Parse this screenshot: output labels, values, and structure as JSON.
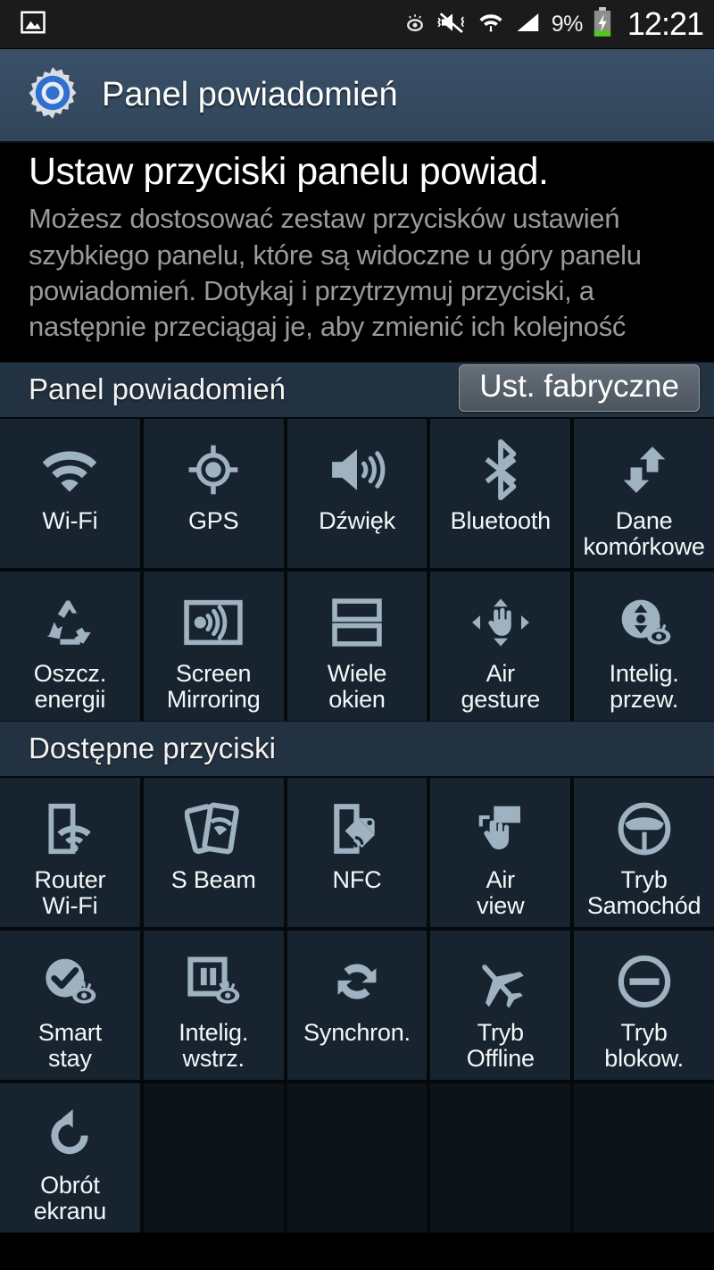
{
  "status_bar": {
    "left_icon": "image-icon",
    "icons": [
      "smart-stay-eye-icon",
      "mute-vibrate-icon",
      "wifi-icon",
      "signal-icon"
    ],
    "battery_percent": "9%",
    "battery_state": "charging",
    "clock": "12:21"
  },
  "action_bar": {
    "icon": "settings-gear-icon",
    "title": "Panel powiadomień"
  },
  "intro": {
    "heading": "Ustaw przyciski panelu powiad.",
    "body": "Możesz dostosować zestaw przycisków ustawień szybkiego panelu, które są widoczne u góry panelu powiadomień. Dotykaj i przytrzymuj przyciski, a następnie przeciągaj je, aby zmienić ich kolejność"
  },
  "panel_section": {
    "title": "Panel powiadomień",
    "reset_button": "Ust. fabryczne",
    "tiles": [
      {
        "label": "Wi-Fi",
        "icon": "wifi-icon"
      },
      {
        "label": "GPS",
        "icon": "gps-crosshair-icon"
      },
      {
        "label": "Dźwięk",
        "icon": "sound-speaker-icon"
      },
      {
        "label": "Bluetooth",
        "icon": "bluetooth-icon"
      },
      {
        "label": "Dane\nkomórkowe",
        "icon": "mobile-data-arrows-icon"
      },
      {
        "label": "Oszcz.\nenergii",
        "icon": "power-saving-recycle-icon"
      },
      {
        "label": "Screen\nMirroring",
        "icon": "screen-mirroring-icon"
      },
      {
        "label": "Wiele\nokien",
        "icon": "multi-window-icon"
      },
      {
        "label": "Air\ngesture",
        "icon": "air-gesture-hand-icon"
      },
      {
        "label": "Intelig.\nprzew.",
        "icon": "smart-scroll-eye-icon"
      }
    ]
  },
  "available_section": {
    "title": "Dostępne przyciski",
    "tiles": [
      {
        "label": "Router\nWi-Fi",
        "icon": "wifi-hotspot-icon"
      },
      {
        "label": "S Beam",
        "icon": "s-beam-icon"
      },
      {
        "label": "NFC",
        "icon": "nfc-tag-icon"
      },
      {
        "label": "Air\nview",
        "icon": "air-view-hand-icon"
      },
      {
        "label": "Tryb\nSamochód",
        "icon": "car-mode-steering-wheel-icon"
      },
      {
        "label": "Smart\nstay",
        "icon": "smart-stay-check-eye-icon"
      },
      {
        "label": "Intelig.\nwstrz.",
        "icon": "smart-pause-eye-icon"
      },
      {
        "label": "Synchron.",
        "icon": "sync-arrows-icon"
      },
      {
        "label": "Tryb\nOffline",
        "icon": "airplane-mode-icon"
      },
      {
        "label": "Tryb\nblokow.",
        "icon": "blocking-mode-minus-icon"
      },
      {
        "label": "Obrót\nekranu",
        "icon": "screen-rotation-icon"
      },
      {
        "label": "",
        "icon": "empty-slot"
      },
      {
        "label": "",
        "icon": "empty-slot"
      },
      {
        "label": "",
        "icon": "empty-slot"
      },
      {
        "label": "",
        "icon": "empty-slot"
      }
    ]
  },
  "colors": {
    "action_bar": "#344a5e",
    "tile_bg": "#17242f",
    "empty_tile_bg": "#0d1419",
    "section_header_bg": "#233240",
    "icon_tint": "#9fb2c1",
    "accent_blue": "#2f6fd0"
  }
}
